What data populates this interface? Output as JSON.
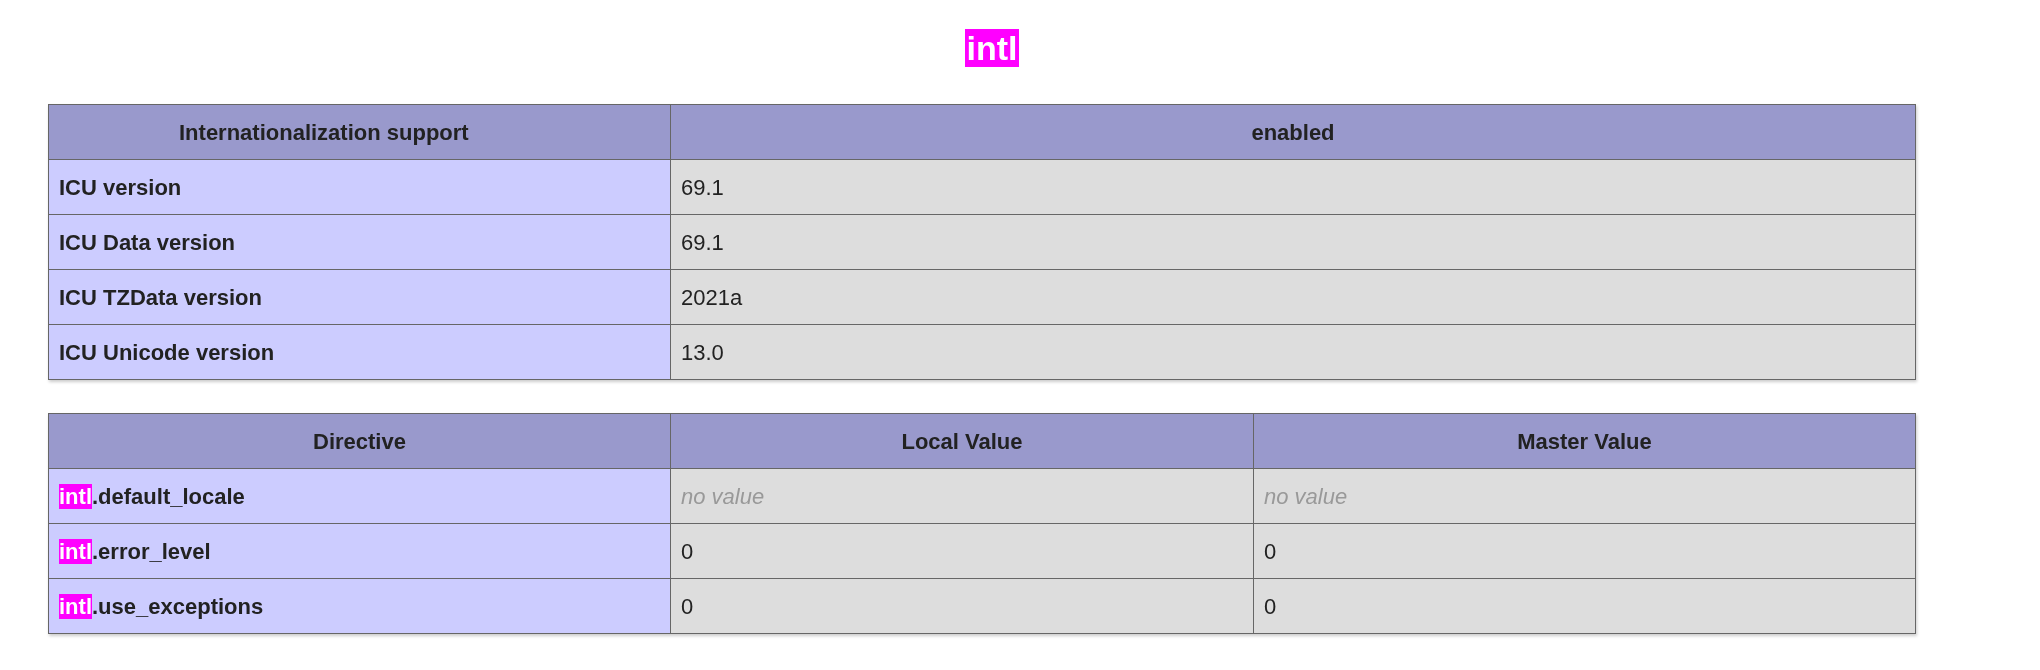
{
  "title": "intl",
  "info_table": {
    "columns": [
      "Internationalization support",
      "enabled"
    ],
    "rows": [
      {
        "label": "ICU version",
        "value": "69.1"
      },
      {
        "label": "ICU Data version",
        "value": "69.1"
      },
      {
        "label": "ICU TZData version",
        "value": "2021a"
      },
      {
        "label": "ICU Unicode version",
        "value": "13.0"
      }
    ]
  },
  "directives_table": {
    "columns": [
      "Directive",
      "Local Value",
      "Master Value"
    ],
    "rows": [
      {
        "match": "intl",
        "rest": ".default_locale",
        "local": "no value",
        "master": "no value",
        "empty": true
      },
      {
        "match": "intl",
        "rest": ".error_level",
        "local": "0",
        "master": "0",
        "empty": false
      },
      {
        "match": "intl",
        "rest": ".use_exceptions",
        "local": "0",
        "master": "0",
        "empty": false
      }
    ]
  }
}
